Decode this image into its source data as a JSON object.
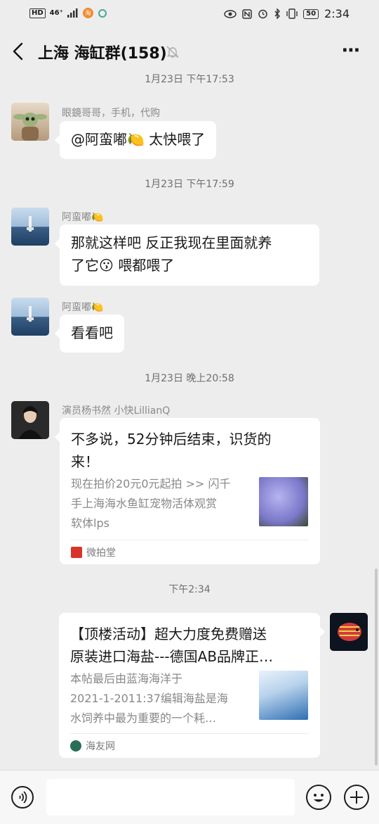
{
  "status_bar": {
    "hd": "HD",
    "network": "46⁺",
    "battery": "50",
    "time": "2:34",
    "icons": [
      "eye-icon",
      "nfc-icon",
      "alarm-icon",
      "bluetooth-icon",
      "vibrate-icon"
    ]
  },
  "header": {
    "title": "上海 海缸群(158)",
    "back_icon": "chevron-left-icon",
    "mute_icon": "bell-off-icon",
    "more_icon": "more-dots-icon"
  },
  "messages": [
    {
      "type": "time",
      "text": "1月23日 下午17:53"
    },
    {
      "type": "text",
      "sender": "眼鏡哥哥，手机，代购",
      "text": "@阿蛮嘟🍋 太快喂了"
    },
    {
      "type": "time",
      "text": "1月23日 下午17:59"
    },
    {
      "type": "text",
      "sender": "阿蛮嘟🍋",
      "text_line1": "那就这样吧  反正我现在里面就养",
      "text_line2": "了它😗  喂都喂了"
    },
    {
      "type": "text",
      "sender": "阿蛮嘟🍋",
      "text": "看看吧"
    },
    {
      "type": "time",
      "text": "1月23日 晚上20:58"
    },
    {
      "type": "card",
      "sender": "演员杨书然 小快LillianQ",
      "title_line1": "不多说，52分钟后结束，识货的",
      "title_line2": "来！",
      "desc_line1": "现在拍价20元0元起拍 >> 闪千",
      "desc_line2": "手上海海水鱼缸宠物活体观赏",
      "desc_line3": "软体lps",
      "source": "微拍堂"
    },
    {
      "type": "time",
      "text": "下午2:34"
    },
    {
      "type": "card",
      "sender": "",
      "title_line1": "【顶楼活动】超大力度免费赠送",
      "title_line2": "原装进口海盐---德国AB品牌正…",
      "desc_line1": "本帖最后由蓝海海洋于",
      "desc_line2": "2021-1-2011:37编辑海盐是海",
      "desc_line3": "水饲养中最为重要的一个耗…",
      "source": "海友网"
    }
  ],
  "input_bar": {
    "voice_icon": "voice-icon",
    "emoji_icon": "emoji-icon",
    "plus_icon": "plus-icon",
    "placeholder": ""
  },
  "colors": {
    "background": "#ededed",
    "bubble": "#ffffff",
    "timestamp": "#6e6e6e",
    "sender": "#8a8a8a"
  }
}
